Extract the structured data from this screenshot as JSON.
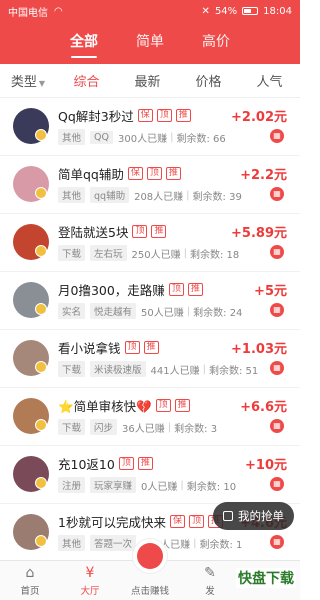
{
  "statusbar": {
    "carrier": "中国电信",
    "battery": "54%",
    "time": "18:04"
  },
  "topnav": {
    "tabs": [
      "全部",
      "简单",
      "高价"
    ]
  },
  "filters": {
    "type_label": "类型",
    "items": [
      "综合",
      "最新",
      "价格",
      "人气"
    ]
  },
  "tasks": [
    {
      "title": "Qq解封3秒过",
      "tags": [
        "保",
        "顶",
        "推"
      ],
      "category": "其他",
      "app": "QQ",
      "joined": "300人已赚",
      "remaining": "剩余数: 66",
      "price": "+2.02元",
      "avatar_color": "#3a3a5a"
    },
    {
      "title": "简单qq辅助",
      "tags": [
        "保",
        "顶",
        "推"
      ],
      "category": "其他",
      "app": "qq辅助",
      "joined": "208人已赚",
      "remaining": "剩余数: 39",
      "price": "+2.2元",
      "avatar_color": "#d99aa7"
    },
    {
      "title": "登陆就送5块",
      "tags": [
        "顶",
        "推"
      ],
      "category": "下载",
      "app": "左右玩",
      "joined": "250人已赚",
      "remaining": "剩余数: 18",
      "price": "+5.89元",
      "avatar_color": "#c4452f"
    },
    {
      "title": "月0撸300，走路赚",
      "tags": [
        "顶",
        "推"
      ],
      "category": "实名",
      "app": "悦走越有",
      "joined": "50人已赚",
      "remaining": "剩余数: 24",
      "price": "+5元",
      "avatar_color": "#8a8f96"
    },
    {
      "title": "看小说拿钱",
      "tags": [
        "顶",
        "推"
      ],
      "category": "下载",
      "app": "米读极速版",
      "joined": "441人已赚",
      "remaining": "剩余数: 51",
      "price": "+1.03元",
      "avatar_color": "#a6887a"
    },
    {
      "title": "⭐简单审核快💔",
      "tags": [
        "顶",
        "推"
      ],
      "category": "下载",
      "app": "闪步",
      "joined": "36人已赚",
      "remaining": "剩余数: 3",
      "price": "+6.6元",
      "avatar_color": "#b07b55"
    },
    {
      "title": "充10返10",
      "tags": [
        "顶",
        "推"
      ],
      "category": "注册",
      "app": "玩家享赚",
      "joined": "0人已赚",
      "remaining": "剩余数: 10",
      "price": "+10元",
      "avatar_color": "#7a4a58"
    },
    {
      "title": "1秒就可以完成快来",
      "tags": [
        "保",
        "顶",
        "推"
      ],
      "category": "其他",
      "app": "答题一次",
      "joined": "759人已赚",
      "remaining": "剩余数: 1",
      "price": "+4.6元",
      "avatar_color": "#9a7c70"
    },
    {
      "title": "一分钟赚5元附",
      "tags": [],
      "category": "",
      "app": "",
      "joined": "",
      "remaining": "",
      "price": "+2元",
      "avatar_color": "#c9a89a"
    }
  ],
  "floating": {
    "my_orders": "我的抢单"
  },
  "tabbar": {
    "items": [
      "首页",
      "大厅",
      "点击赚钱",
      "发"
    ]
  },
  "watermark": "快盘下载",
  "colors": {
    "accent": "#ef4a4a"
  },
  "icons": {
    "wifi": "wifi-icon",
    "battery": "battery-icon",
    "home": "home-icon",
    "hall": "yuan-icon",
    "center": "red-packet-icon",
    "publish": "publish-icon",
    "grid": "grid-icon",
    "calendar": "calendar-icon"
  }
}
